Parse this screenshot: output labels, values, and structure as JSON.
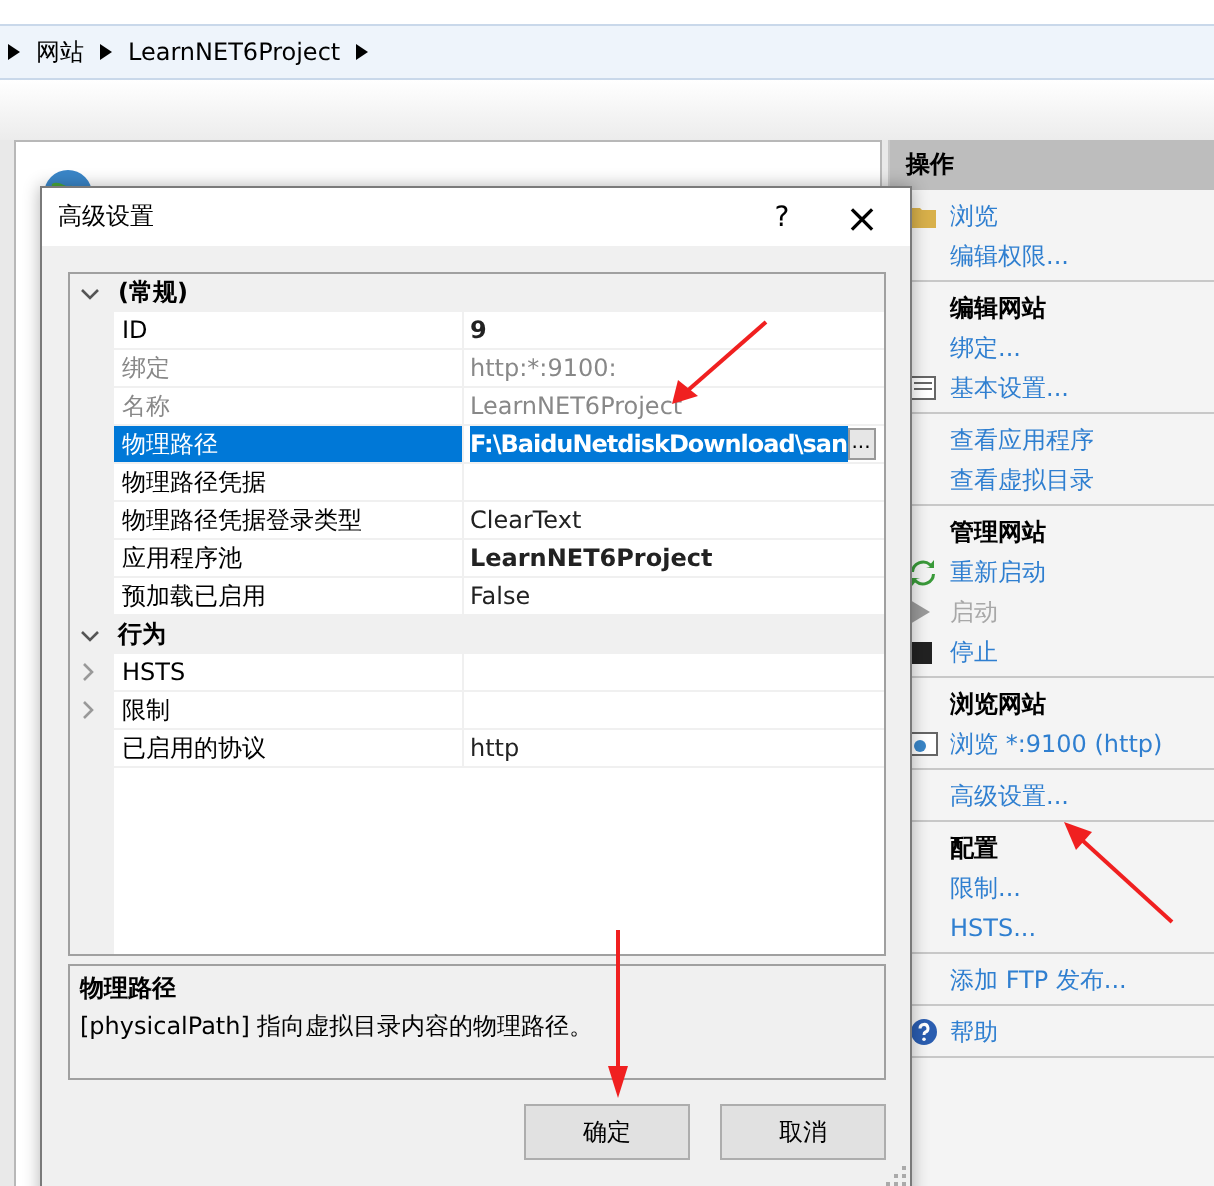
{
  "breadcrumb": [
    "网站",
    "LearnNET6Project"
  ],
  "actions": {
    "title": "操作",
    "sections": [
      {
        "items": [
          {
            "label": "浏览",
            "disabled": false
          },
          {
            "label": "编辑权限...",
            "disabled": false
          }
        ]
      },
      {
        "heading": "编辑网站",
        "items": [
          {
            "label": "绑定...",
            "disabled": false
          },
          {
            "label": "基本设置...",
            "disabled": false
          }
        ]
      },
      {
        "items": [
          {
            "label": "查看应用程序",
            "disabled": false
          },
          {
            "label": "查看虚拟目录",
            "disabled": false
          }
        ]
      },
      {
        "heading": "管理网站",
        "items": [
          {
            "label": "重新启动",
            "disabled": false
          },
          {
            "label": "启动",
            "disabled": true
          },
          {
            "label": "停止",
            "disabled": false
          }
        ]
      },
      {
        "heading": "浏览网站",
        "items": [
          {
            "label": "浏览 *:9100 (http)",
            "disabled": false
          }
        ]
      },
      {
        "items": [
          {
            "label": "高级设置...",
            "disabled": false
          }
        ]
      },
      {
        "heading": "配置",
        "items": [
          {
            "label": "限制...",
            "disabled": false
          },
          {
            "label": "HSTS...",
            "disabled": false
          }
        ]
      },
      {
        "items": [
          {
            "label": "添加 FTP 发布...",
            "disabled": false
          }
        ]
      },
      {
        "items": [
          {
            "label": "帮助",
            "disabled": false
          }
        ]
      }
    ]
  },
  "dialog": {
    "title": "高级设置",
    "help": "?",
    "close": "×",
    "categories": [
      {
        "name": "(常规)",
        "expanded": true,
        "rows": [
          {
            "kind": "property",
            "name": "ID",
            "value": "9",
            "disabled": false,
            "bold": true,
            "selected": false
          },
          {
            "kind": "property",
            "name": "绑定",
            "value": "http:*:9100:",
            "disabled": true,
            "bold": false,
            "selected": false
          },
          {
            "kind": "property",
            "name": "名称",
            "value": "LearnNET6Project",
            "disabled": true,
            "bold": false,
            "selected": false
          },
          {
            "kind": "property",
            "name": "物理路径",
            "value": "F:\\BaiduNetdiskDownload\\san",
            "disabled": false,
            "bold": true,
            "selected": true,
            "browse": "..."
          },
          {
            "kind": "property",
            "name": "物理路径凭据",
            "disabled": false,
            "selected": false
          },
          {
            "kind": "property",
            "name": "物理路径凭据登录类型",
            "value": "ClearText",
            "disabled": false,
            "bold": false,
            "selected": false
          },
          {
            "kind": "property",
            "name": "应用程序池",
            "value": "LearnNET6Project",
            "disabled": false,
            "bold": true,
            "selected": false
          },
          {
            "kind": "property",
            "name": "预加载已启用",
            "value": "False",
            "disabled": false,
            "bold": false,
            "selected": false
          }
        ]
      },
      {
        "name": "行为",
        "expanded": true,
        "rows": [
          {
            "kind": "group",
            "name": "HSTS",
            "expanded": false,
            "selected": false
          },
          {
            "kind": "group",
            "name": "限制",
            "expanded": false,
            "selected": false
          },
          {
            "kind": "property",
            "name": "已启用的协议",
            "value": "http",
            "disabled": false,
            "bold": false,
            "selected": false
          }
        ]
      }
    ],
    "description": {
      "title": "物理路径",
      "text": "[physicalPath] 指向虚拟目录内容的物理路径。"
    },
    "buttons": [
      "确定",
      "取消"
    ]
  }
}
